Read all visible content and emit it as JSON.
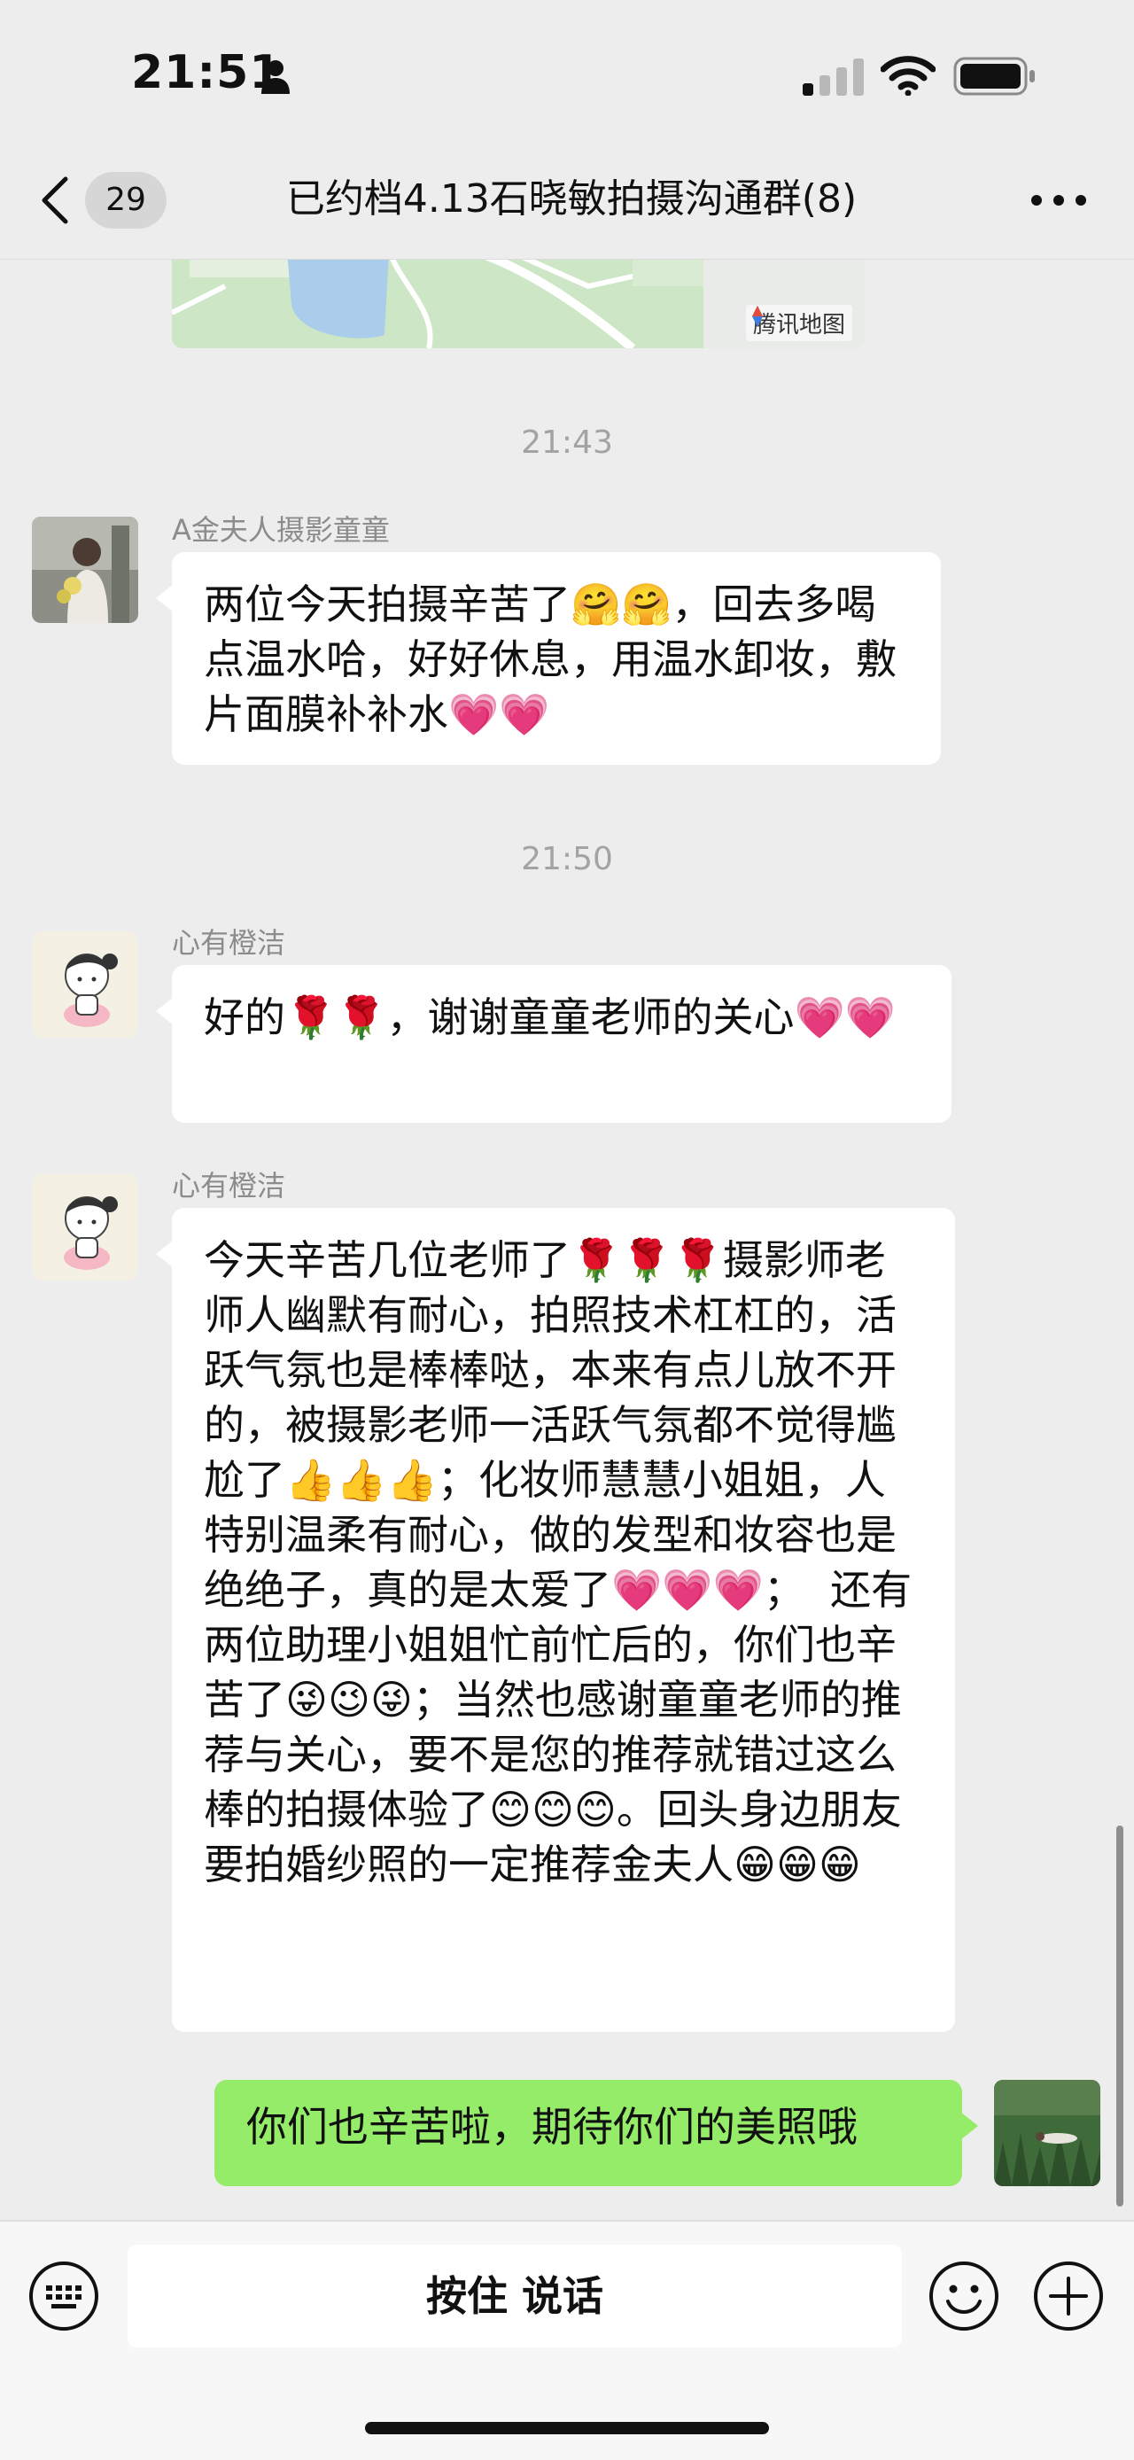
{
  "status_bar": {
    "time": "21:51",
    "icons": [
      "person-icon",
      "signal-icon",
      "wifi-icon",
      "battery-icon"
    ]
  },
  "header": {
    "back_icon": "chevron-left-icon",
    "unread_count": "29",
    "title": "已约档4.13石晓敏拍摄沟通群(8)",
    "more_icon": "more-dots-icon"
  },
  "map_card": {
    "watermark": "腾讯地图"
  },
  "messages": [
    {
      "type": "timestamp",
      "text": "21:43"
    },
    {
      "type": "message",
      "side": "left",
      "sender": "A金夫人摄影童童",
      "avatar": "avatar-photo-woman",
      "text": "两位今天拍摄辛苦了🤗🤗，回去多喝点温水哈，好好休息，用温水卸妆，敷片面膜补补水💗💗"
    },
    {
      "type": "timestamp",
      "text": "21:50"
    },
    {
      "type": "message",
      "side": "left",
      "sender": "心有橙洁",
      "avatar": "avatar-cartoon-girl",
      "text": "好的🌹🌹，谢谢童童老师的关心💗💗"
    },
    {
      "type": "message",
      "side": "left",
      "sender": "心有橙洁",
      "avatar": "avatar-cartoon-girl",
      "text": "今天辛苦几位老师了🌹🌹🌹摄影师老师人幽默有耐心，拍照技术杠杠的，活跃气氛也是棒棒哒，本来有点儿放不开的，被摄影老师一活跃气氛都不觉得尴尬了👍👍👍；化妆师慧慧小姐姐，人特别温柔有耐心，做的发型和妆容也是绝绝子，真的是太爱了💗💗💗；  还有两位助理小姐姐忙前忙后的，你们也辛苦了😜😉😜；当然也感谢童童老师的推荐与关心，要不是您的推荐就错过这么棒的拍摄体验了😊😊😊。回头身边朋友要拍婚纱照的一定推荐金夫人😁😁😁"
    },
    {
      "type": "message",
      "side": "right",
      "avatar": "avatar-self-grass",
      "text": "你们也辛苦啦，期待你们的美照哦"
    }
  ],
  "input_bar": {
    "voice_button_label": "按住 说话",
    "left_icon": "keyboard-icon",
    "emoji_icon": "emoji-icon",
    "plus_icon": "plus-icon"
  },
  "colors": {
    "background": "#ededed",
    "bubble_left": "#ffffff",
    "bubble_right": "#95ec69",
    "timestamp_text": "#a3a3a3",
    "sender_text": "#8c8c8c"
  }
}
